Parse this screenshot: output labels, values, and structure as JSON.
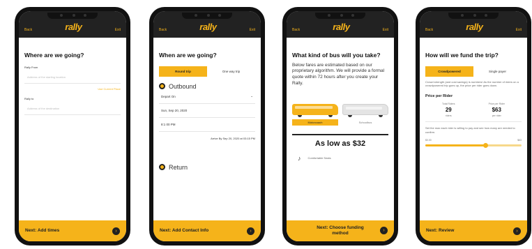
{
  "brand": {
    "logo": "rally",
    "accent": "#f5b31a",
    "dark": "#222222"
  },
  "screens": [
    {
      "nav_back": "Back",
      "nav_exit": "Exit",
      "title": "Where are we going?",
      "from_label": "Rally From",
      "from_placeholder": "Address of the starting location",
      "current_location": "Use Current Place",
      "to_label": "Rally to",
      "to_placeholder": "Address of the destination",
      "cta": "Next: Add times"
    },
    {
      "nav_back": "Back",
      "nav_exit": "Exit",
      "title": "When are we going?",
      "toggle": [
        "Round trip",
        "One way trip"
      ],
      "outbound_label": "Outbound",
      "depart_label": "Depart On",
      "date": "Sun, Sep 20, 2020",
      "time": "8:1 ⁠00 PM",
      "arrive": "Arrive By Sep 20, 2020 at 03:15 PM",
      "return_label": "Return",
      "cta": "Next: Add Contact Info"
    },
    {
      "nav_back": "Back",
      "nav_exit": "Exit",
      "title": "What kind of bus will you take?",
      "body": "Below fares are estimated based on our proprietary algorithm. We will provide a formal quote within 72 hours after you create your Rally.",
      "bus_options": [
        "Motorcoach",
        "Schoolbus"
      ],
      "price": "As low as $32",
      "seat_note": "Comfortable Seats",
      "cta": "Next: Choose funding method"
    },
    {
      "nav_back": "Back",
      "nav_exit": "Exit",
      "title": "How will we fund the trip?",
      "toggle": [
        "Crowdpowered",
        "Single payer"
      ],
      "body": "Crowd strength (and cost savings) is numbers! As the number of riders on a crowdpowered trip goes up, the price per rider goes down.",
      "price_section": "Price per Rider",
      "stats": [
        {
          "k": "Total Riders",
          "v": "29",
          "u": "riders"
        },
        {
          "k": "Price per Rider",
          "v": "$63",
          "u": "per rider"
        }
      ],
      "slider_hint": "Set the max each rider is willing to pay and see how many are needed to confirm.",
      "slider_min": "$0.00",
      "slider_max": "$63",
      "slider_level": 0.62,
      "cta": "Next: Review"
    }
  ]
}
